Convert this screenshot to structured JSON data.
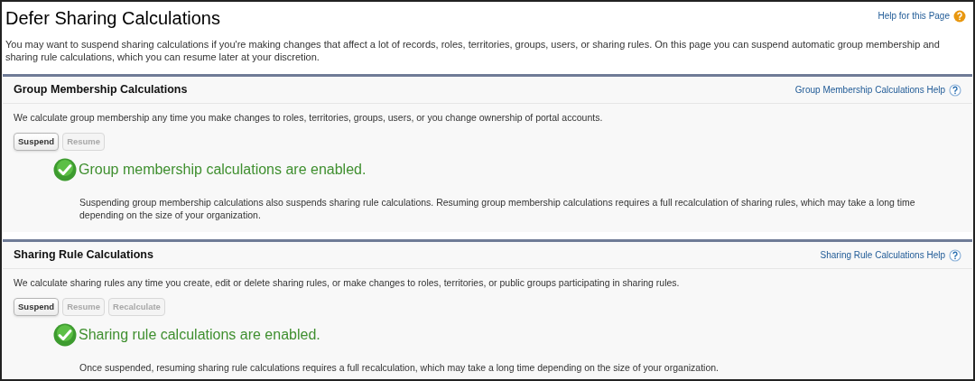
{
  "page": {
    "title": "Defer Sharing Calculations",
    "help_link": "Help for this Page",
    "intro": "You may want to suspend sharing calculations if you're making changes that affect a lot of records, roles, territories, groups, users, or sharing rules. On this page you can suspend automatic group membership and sharing rule calculations, which you can resume later at your discretion."
  },
  "sections": [
    {
      "title": "Group Membership Calculations",
      "help_link": "Group Membership Calculations Help",
      "description": "We calculate group membership any time you make changes to roles, territories, groups, users, or you change ownership of portal accounts.",
      "buttons": [
        {
          "label": "Suspend",
          "disabled": false
        },
        {
          "label": "Resume",
          "disabled": true
        }
      ],
      "status": "Group membership calculations are enabled.",
      "note": "Suspending group membership calculations also suspends sharing rule calculations. Resuming group membership calculations requires a full recalculation of sharing rules, which may take a long time depending on the size of your organization."
    },
    {
      "title": "Sharing Rule Calculations",
      "help_link": "Sharing Rule Calculations Help",
      "description": "We calculate sharing rules any time you create, edit or delete sharing rules, or make changes to roles, territories, or public groups participating in sharing rules.",
      "buttons": [
        {
          "label": "Suspend",
          "disabled": false
        },
        {
          "label": "Resume",
          "disabled": true
        },
        {
          "label": "Recalculate",
          "disabled": true
        }
      ],
      "status": "Sharing rule calculations are enabled.",
      "note": "Once suspended, resuming sharing rule calculations requires a full recalculation, which may take a long time depending on the size of your organization."
    }
  ]
}
